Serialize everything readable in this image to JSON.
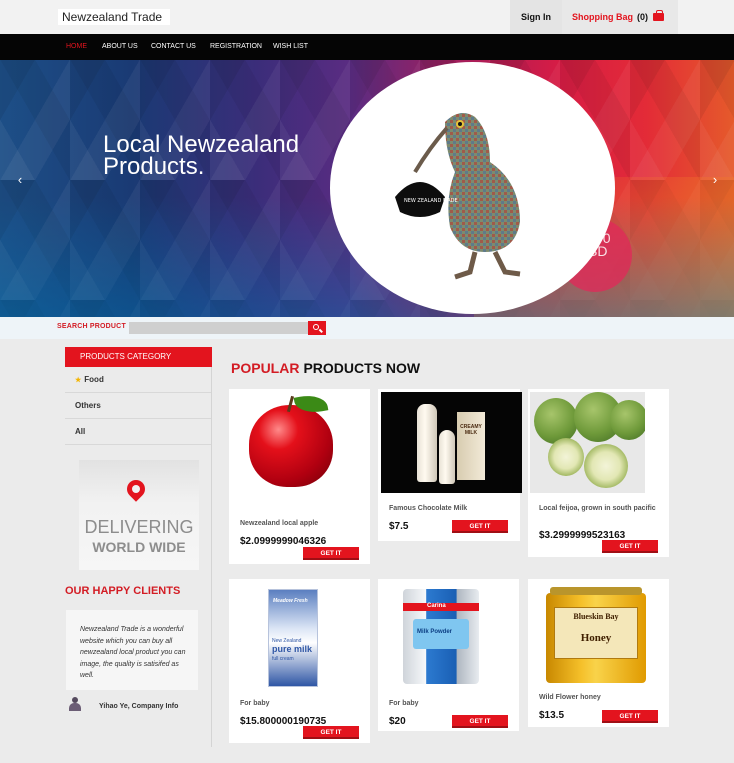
{
  "header": {
    "logo_part1": "Newzealand ",
    "logo_part2": "Trade",
    "signin_label": "Sign In",
    "bag_label": "Shopping Bag",
    "bag_count": "(0)"
  },
  "nav": {
    "items": [
      {
        "label": "HOME",
        "active": true
      },
      {
        "label": "ABOUT US"
      },
      {
        "label": "CONTACT US"
      },
      {
        "label": "REGISTRATION"
      },
      {
        "label": "WISH LIST"
      }
    ]
  },
  "hero": {
    "title_line1": "Local Newzealand",
    "title_line2": "Products.",
    "arrow_left": "‹",
    "arrow_right": "›"
  },
  "search": {
    "label": "SEARCH PRODUCT",
    "placeholder": ""
  },
  "sidebar": {
    "category_header": "PRODUCTS CATEGORY",
    "categories": [
      {
        "label": "Food",
        "starred": true
      },
      {
        "label": "Others"
      },
      {
        "label": "All"
      }
    ],
    "delivering_line1": "DELIVERING",
    "delivering_line2": "WORLD WIDE",
    "clients_title": "OUR HAPPY CLIENTS",
    "testimonial_text": "Newzealand Trade is a wonderful website which you can buy all newzealand local product you can image, the quality is satisifed as well.",
    "client_name": "Yihao Ye, Company Info"
  },
  "products": {
    "title_red": "POPULAR",
    "title_rest": "PRODUCTS NOW",
    "get_label": "GET IT",
    "items": [
      {
        "name": "Newzealand local apple",
        "price": "$2.0999999046326"
      },
      {
        "name": "Famous Chocolate Milk",
        "price": "$7.5"
      },
      {
        "name": "Local feijoa, grown in south pacific",
        "price": "$3.2999999523163"
      },
      {
        "name": "For baby",
        "price": "$15.800000190735"
      },
      {
        "name": "For baby",
        "price": "$20"
      },
      {
        "name": "Wild Flower honey",
        "price": "$13.5"
      }
    ]
  },
  "decor": {
    "bag_tag_text": "NEW ZEALAND MADE",
    "milk_box_text": "CREAMY MILK",
    "baby_box_brand": "Meadow Fresh",
    "baby_box_line1": "New Zealand",
    "baby_box_line2": "pure milk",
    "baby_box_line3": "full cream",
    "tin_brand": "Carina",
    "tin_text": "Milk Powder",
    "honey_brand": "Blueskin Bay",
    "honey_word": "Honey",
    "hero_badge_text": "ct 0 SD"
  },
  "colors": {
    "accent": "#e3141e",
    "nav_bg": "#050505"
  }
}
